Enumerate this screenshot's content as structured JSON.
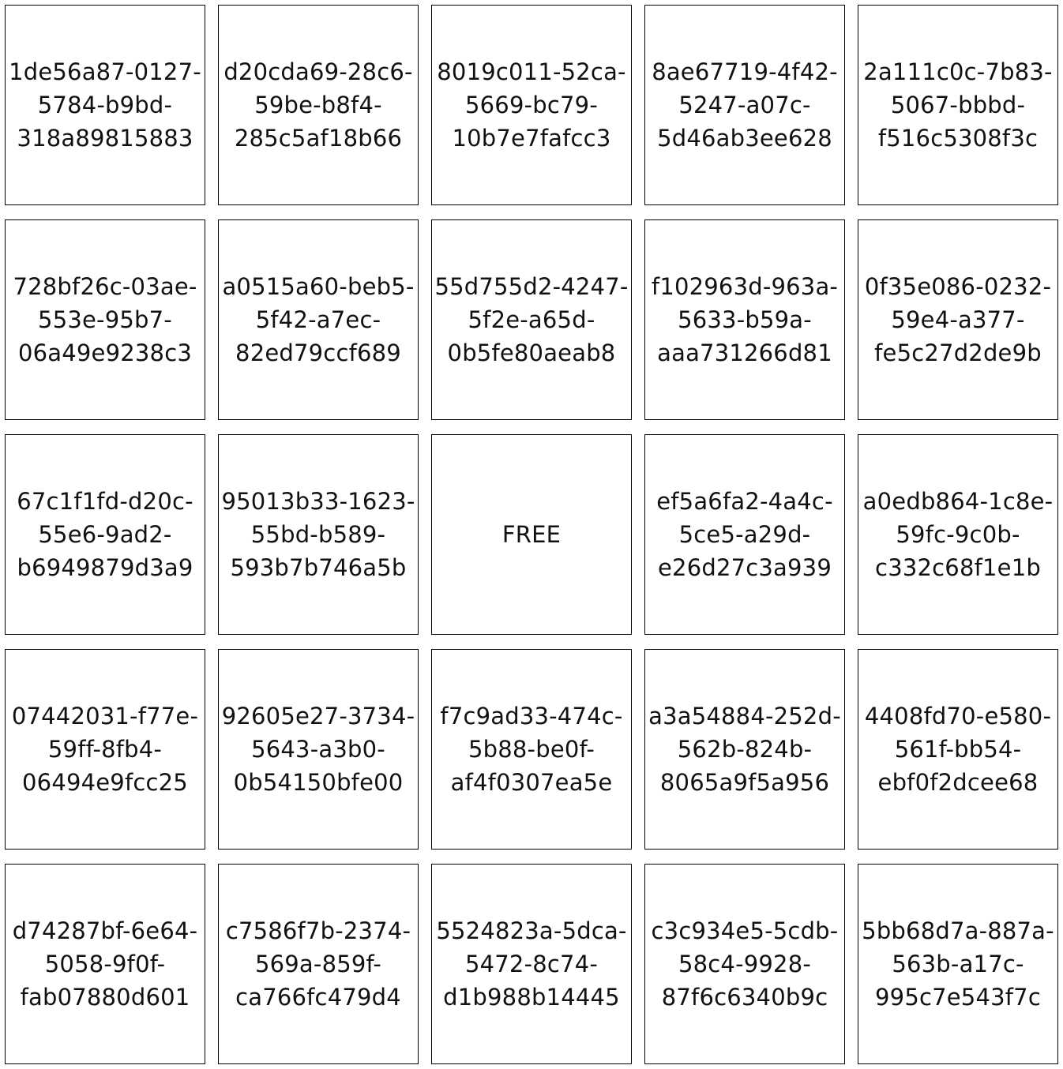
{
  "board": {
    "rows": [
      [
        {
          "lines": [
            "1de56a87-0127-",
            "5784-b9bd-",
            "318a89815883"
          ]
        },
        {
          "lines": [
            "d20cda69-28c6-",
            "59be-b8f4-",
            "285c5af18b66"
          ]
        },
        {
          "lines": [
            "8019c011-52ca-",
            "5669-bc79-",
            "10b7e7fafcc3"
          ]
        },
        {
          "lines": [
            "8ae67719-4f42-",
            "5247-a07c-",
            "5d46ab3ee628"
          ]
        },
        {
          "lines": [
            "2a111c0c-7b83-",
            "5067-bbbd-",
            "f516c5308f3c"
          ]
        }
      ],
      [
        {
          "lines": [
            "728bf26c-03ae-",
            "553e-95b7-",
            "06a49e9238c3"
          ]
        },
        {
          "lines": [
            "a0515a60-beb5-",
            "5f42-a7ec-",
            "82ed79ccf689"
          ]
        },
        {
          "lines": [
            "55d755d2-4247-",
            "5f2e-a65d-",
            "0b5fe80aeab8"
          ]
        },
        {
          "lines": [
            "f102963d-963a-",
            "5633-b59a-",
            "aaa731266d81"
          ]
        },
        {
          "lines": [
            "0f35e086-0232-",
            "59e4-a377-",
            "fe5c27d2de9b"
          ]
        }
      ],
      [
        {
          "lines": [
            "67c1f1fd-d20c-",
            "55e6-9ad2-",
            "b6949879d3a9"
          ]
        },
        {
          "lines": [
            "95013b33-1623-",
            "55bd-b589-",
            "593b7b746a5b"
          ]
        },
        {
          "lines": [
            "FREE"
          ]
        },
        {
          "lines": [
            "ef5a6fa2-4a4c-",
            "5ce5-a29d-",
            "e26d27c3a939"
          ]
        },
        {
          "lines": [
            "a0edb864-1c8e-",
            "59fc-9c0b-",
            "c332c68f1e1b"
          ]
        }
      ],
      [
        {
          "lines": [
            "07442031-f77e-",
            "59ff-8fb4-",
            "06494e9fcc25"
          ]
        },
        {
          "lines": [
            "92605e27-3734-",
            "5643-a3b0-",
            "0b54150bfe00"
          ]
        },
        {
          "lines": [
            "f7c9ad33-474c-",
            "5b88-be0f-",
            "af4f0307ea5e"
          ]
        },
        {
          "lines": [
            "a3a54884-252d-",
            "562b-824b-",
            "8065a9f5a956"
          ]
        },
        {
          "lines": [
            "4408fd70-e580-",
            "561f-bb54-",
            "ebf0f2dcee68"
          ]
        }
      ],
      [
        {
          "lines": [
            "d74287bf-6e64-",
            "5058-9f0f-",
            "fab07880d601"
          ]
        },
        {
          "lines": [
            "c7586f7b-2374-",
            "569a-859f-",
            "ca766fc479d4"
          ]
        },
        {
          "lines": [
            "5524823a-5dca-",
            "5472-8c74-",
            "d1b988b14445"
          ]
        },
        {
          "lines": [
            "c3c934e5-5cdb-",
            "58c4-9928-",
            "87f6c6340b9c"
          ]
        },
        {
          "lines": [
            "5bb68d7a-887a-",
            "563b-a17c-",
            "995c7e543f7c"
          ]
        }
      ]
    ]
  }
}
